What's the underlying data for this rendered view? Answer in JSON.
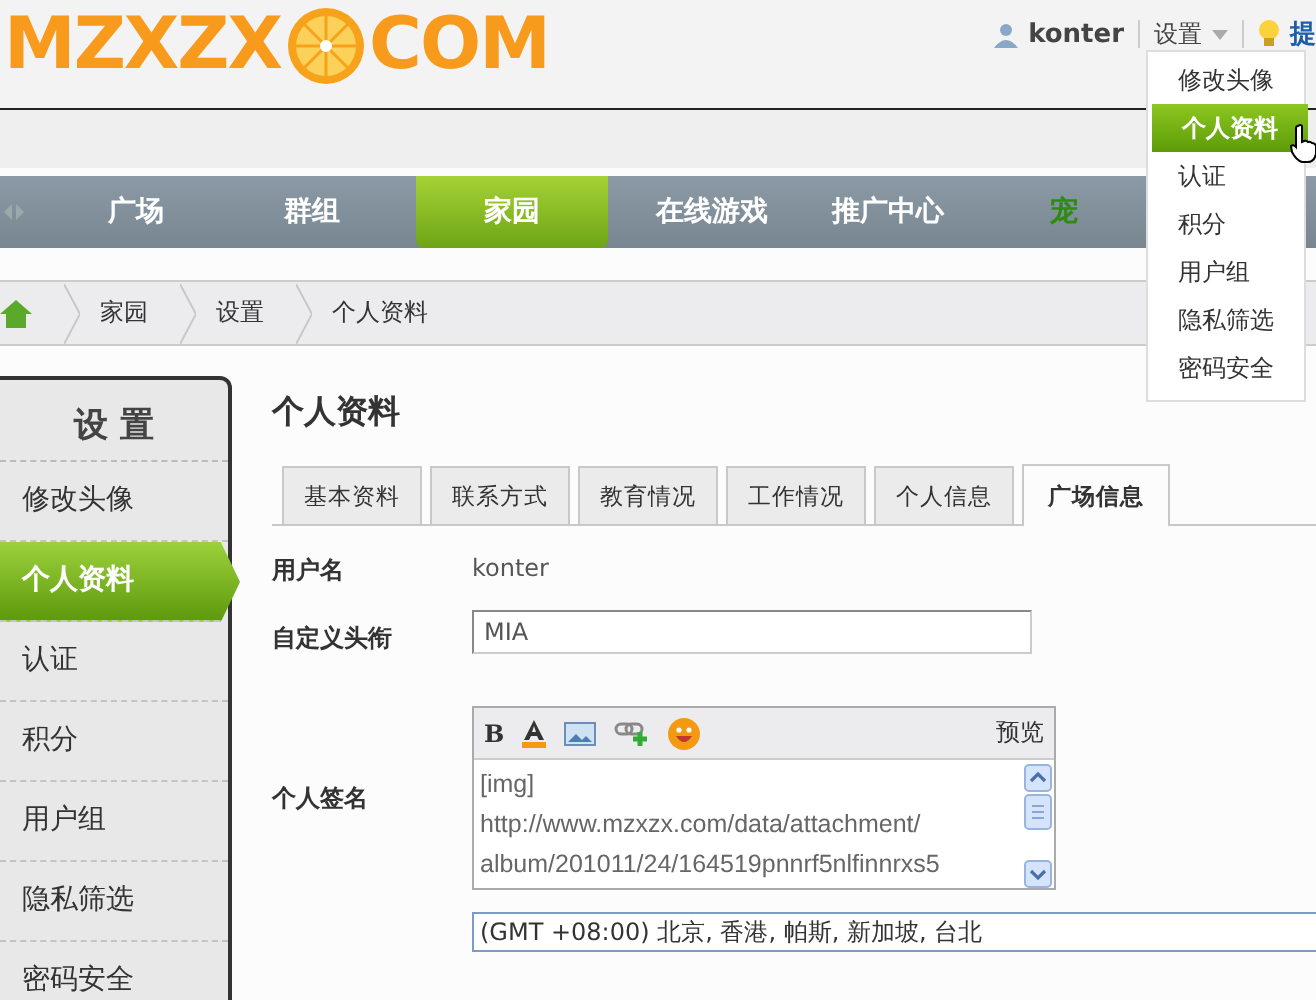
{
  "logo": {
    "left": "MZXZX",
    "right": "COM"
  },
  "top_bar": {
    "username": "konter",
    "settings": "设置",
    "reminder": "提"
  },
  "settings_menu": [
    {
      "label": "修改头像",
      "selected": false
    },
    {
      "label": "个人资料",
      "selected": true
    },
    {
      "label": "认证",
      "selected": false
    },
    {
      "label": "积分",
      "selected": false
    },
    {
      "label": "用户组",
      "selected": false
    },
    {
      "label": "隐私筛选",
      "selected": false
    },
    {
      "label": "密码安全",
      "selected": false
    }
  ],
  "nav": [
    {
      "label": "广场",
      "selected": false
    },
    {
      "label": "群组",
      "selected": false
    },
    {
      "label": "家园",
      "selected": true
    },
    {
      "label": "在线游戏",
      "selected": false
    },
    {
      "label": "推广中心",
      "selected": false
    },
    {
      "label": "宠",
      "selected": false,
      "highlight": true
    }
  ],
  "breadcrumb": [
    "家园",
    "设置",
    "个人资料"
  ],
  "sidebar": {
    "title": "设 置",
    "items": [
      {
        "label": "修改头像",
        "selected": false
      },
      {
        "label": "个人资料",
        "selected": true
      },
      {
        "label": "认证",
        "selected": false
      },
      {
        "label": "积分",
        "selected": false
      },
      {
        "label": "用户组",
        "selected": false
      },
      {
        "label": "隐私筛选",
        "selected": false
      },
      {
        "label": "密码安全",
        "selected": false
      }
    ]
  },
  "page_title": "个人资料",
  "tabs": [
    {
      "label": "基本资料",
      "selected": false
    },
    {
      "label": "联系方式",
      "selected": false
    },
    {
      "label": "教育情况",
      "selected": false
    },
    {
      "label": "工作情况",
      "selected": false
    },
    {
      "label": "个人信息",
      "selected": false
    },
    {
      "label": "广场信息",
      "selected": true
    }
  ],
  "form": {
    "username_label": "用户名",
    "username": "konter",
    "title_label": "自定义头衔",
    "title_value": "MIA",
    "signature_label": "个人签名",
    "bold_button": "B",
    "preview": "预览",
    "signature_lines": [
      "[img]",
      "http://www.mzxzx.com/data/attachment/",
      "album/201011/24/164519pnnrf5nlfinnrxs5"
    ],
    "timezone": "(GMT +08:00) 北京, 香港, 帕斯, 新加坡, 台北"
  }
}
